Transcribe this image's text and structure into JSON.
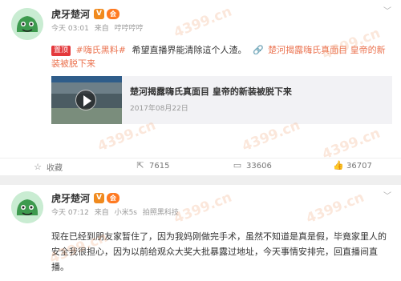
{
  "post1": {
    "username": "虎牙楚河",
    "verified_mark": "V",
    "vip_mark": "会",
    "time": "今天 03:01",
    "source_prefix": "来自",
    "source": "哼哼哼哼",
    "pin_badge": "置顶",
    "hashtag": "#嗨氏黑料#",
    "body": "希望直播界能清除這个人渣。",
    "link_text": "楚河揭露嗨氏真面目 皇帝的新装被脱下来",
    "share_card": {
      "title": "楚河揭露嗨氏真面目 皇帝的新装被脱下来",
      "date": "2017年08月22日"
    },
    "actions": {
      "favorite": "收藏",
      "share_count": "7615",
      "comment_count": "33606",
      "like_count": "36707"
    }
  },
  "post2": {
    "username": "虎牙楚河",
    "verified_mark": "V",
    "vip_mark": "会",
    "time": "今天 07:12",
    "source_prefix": "来自",
    "source": "小米5s",
    "source_suffix": "拍照黑科技",
    "body": "现在已经到朋友家暂住了，因为我妈刚做完手术，虽然不知道是真是假，毕竟家里人的安全我很担心，因为以前给观众大奖大批暴露过地址，今天事情安排完，回直播间直播。"
  },
  "watermark_text": "4399.cn",
  "colors": {
    "link": "#eb7350",
    "badge": "#e4393c",
    "verified": "#f08a1e",
    "background": "#efefef"
  },
  "icons": {
    "favorite": "star-icon",
    "share": "share-icon",
    "comment": "comment-icon",
    "like": "thumbs-up-icon",
    "menu": "chevron-down-icon",
    "link": "link-icon",
    "play": "play-icon"
  }
}
